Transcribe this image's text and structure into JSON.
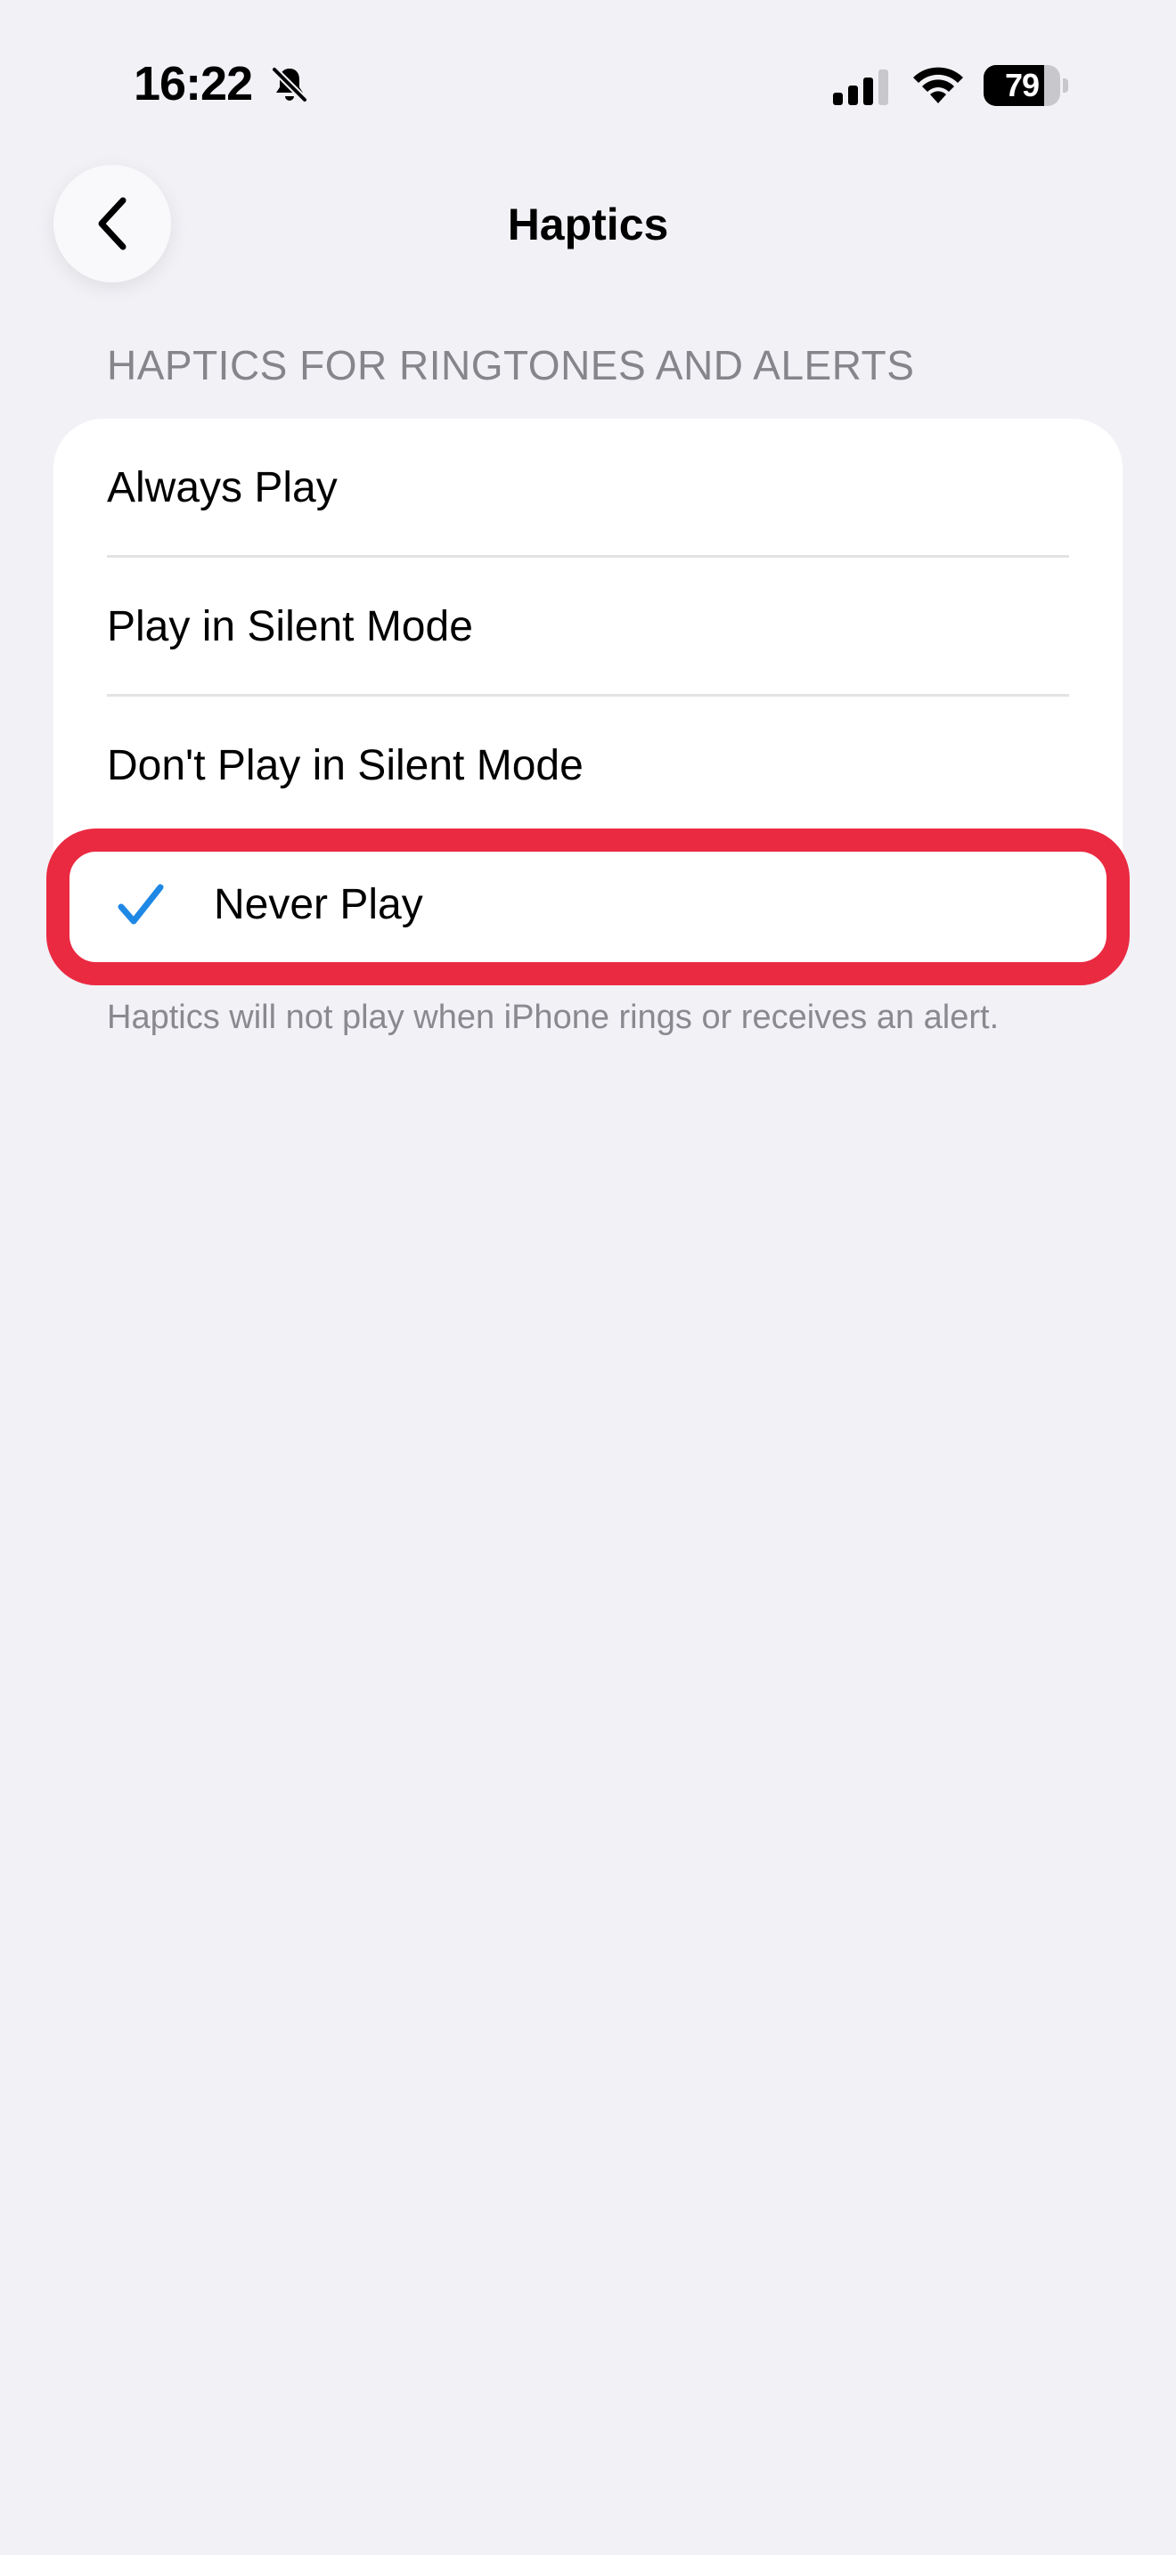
{
  "status_bar": {
    "time": "16:22",
    "battery_level": "79",
    "battery_fraction": 0.79,
    "icons": [
      "bell-slash-icon",
      "cellular-signal-icon",
      "wifi-icon",
      "battery-icon"
    ]
  },
  "nav": {
    "title": "Haptics",
    "back_icon": "chevron-left-icon"
  },
  "section": {
    "header": "HAPTICS FOR RINGTONES AND ALERTS",
    "options": [
      {
        "label": "Always Play",
        "selected": false
      },
      {
        "label": "Play in Silent Mode",
        "selected": false
      },
      {
        "label": "Don't Play in Silent Mode",
        "selected": false
      },
      {
        "label": "Never Play",
        "selected": true
      }
    ],
    "footer": "Haptics will not play when iPhone rings or receives an alert."
  },
  "colors": {
    "background": "#F2F1F6",
    "card": "#FFFFFF",
    "accent_checkmark": "#1E88E5",
    "highlight": "#EA2A41",
    "secondary_text": "#86858B"
  }
}
